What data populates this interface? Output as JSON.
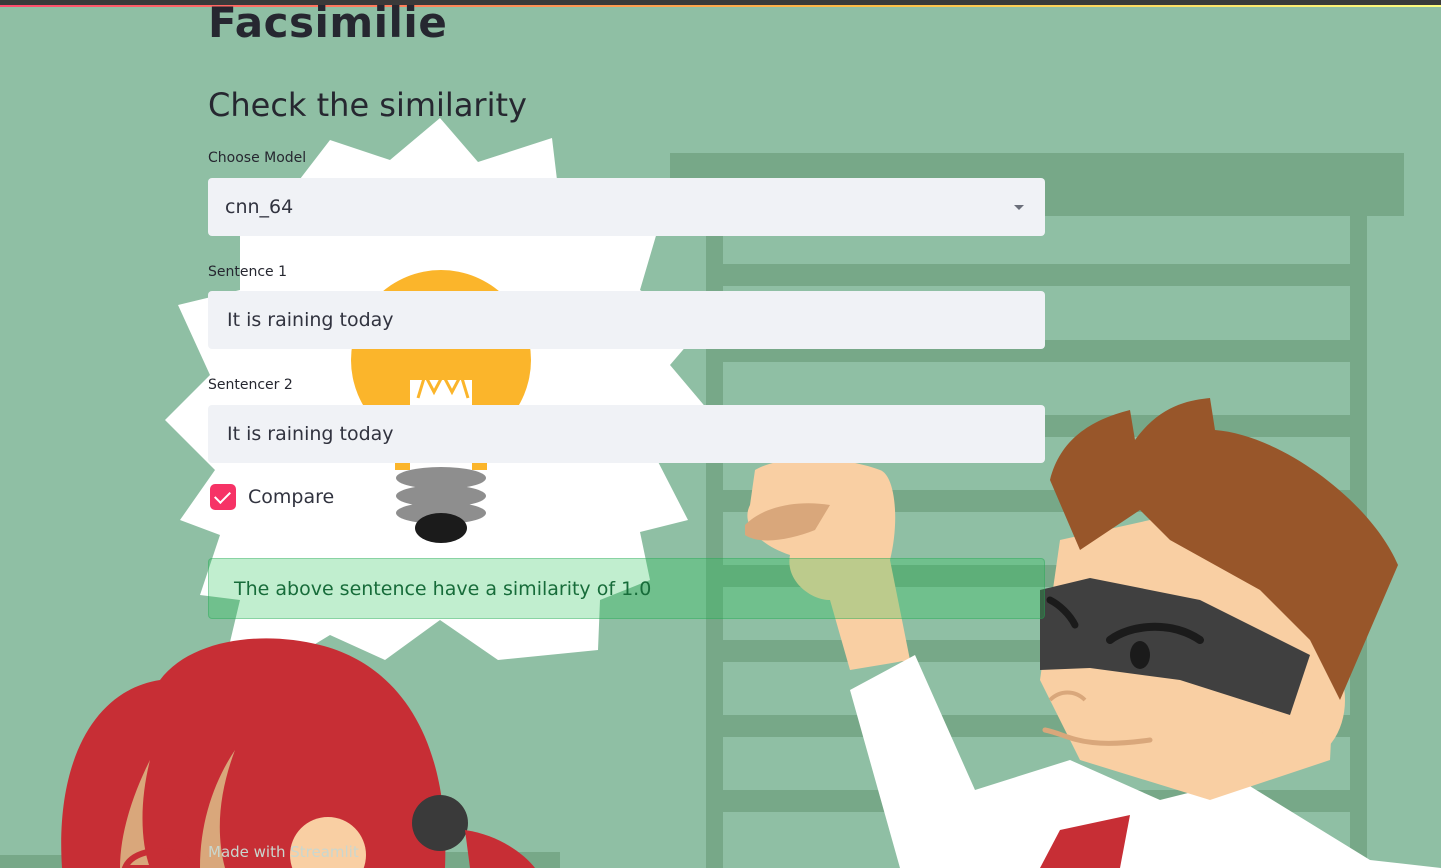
{
  "app": {
    "title": "Facsimilie",
    "subheader": "Check the similarity"
  },
  "form": {
    "model": {
      "label": "Choose Model",
      "value": "cnn_64"
    },
    "sentence1": {
      "label": "Sentence 1",
      "value": "It is raining today"
    },
    "sentence2": {
      "label": "Sentencer 2",
      "value": "It is raining today"
    },
    "compare": {
      "label": "Compare",
      "checked": true
    }
  },
  "result": {
    "message": "The above sentence have a similarity of 1.0"
  },
  "footer": {
    "text": "Made with Streamlit"
  },
  "colors": {
    "background": "#8fbfa4",
    "accent": "#f63366",
    "input_bg": "#f0f2f6",
    "success_text": "#176c3a"
  }
}
